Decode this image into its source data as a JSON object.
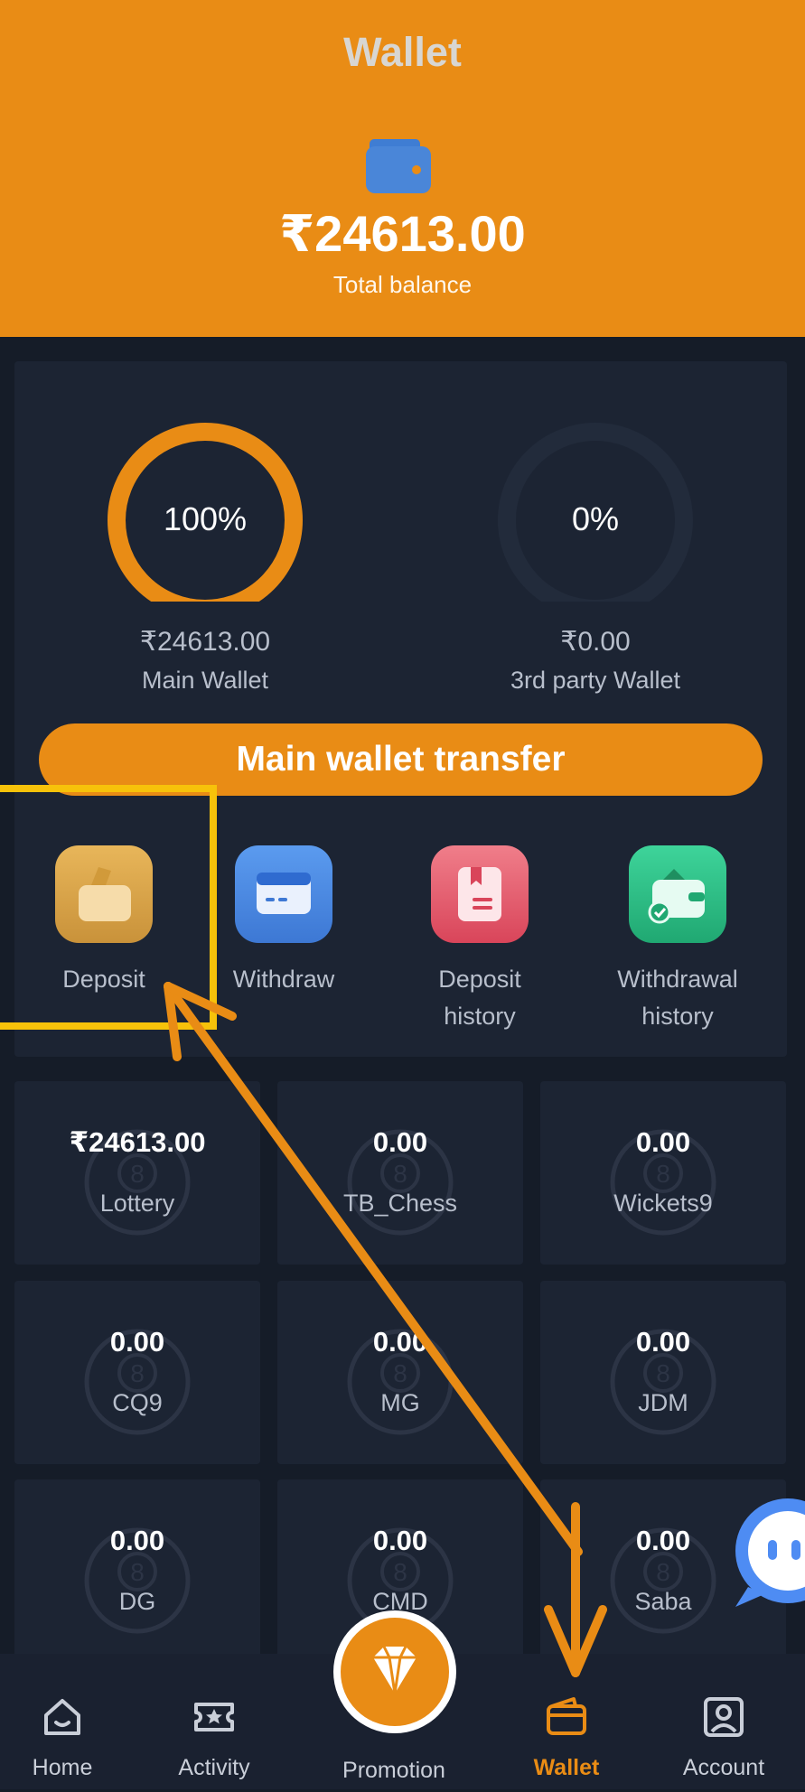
{
  "header": {
    "title": "Wallet",
    "total_amount": "₹24613.00",
    "total_label": "Total balance",
    "icon": "wallet-icon"
  },
  "wallets": {
    "main": {
      "percent": "100%",
      "amount": "₹24613.00",
      "label": "Main Wallet",
      "fill": 1.0
    },
    "third_party": {
      "percent": "0%",
      "amount": "₹0.00",
      "label": "3rd party Wallet",
      "fill": 0.0
    }
  },
  "transfer_button": "Main wallet transfer",
  "actions": [
    {
      "label": "Deposit",
      "icon": "deposit-icon"
    },
    {
      "label": "Withdraw",
      "icon": "withdraw-card-icon"
    },
    {
      "label": "Deposit history",
      "icon": "deposit-history-icon"
    },
    {
      "label": "Withdrawal history",
      "icon": "withdrawal-history-icon"
    }
  ],
  "games": [
    {
      "value": "₹24613.00",
      "name": "Lottery"
    },
    {
      "value": "0.00",
      "name": "TB_Chess"
    },
    {
      "value": "0.00",
      "name": "Wickets9"
    },
    {
      "value": "0.00",
      "name": "CQ9"
    },
    {
      "value": "0.00",
      "name": "MG"
    },
    {
      "value": "0.00",
      "name": "JDM"
    },
    {
      "value": "0.00",
      "name": "DG"
    },
    {
      "value": "0.00",
      "name": "CMD"
    },
    {
      "value": "0.00",
      "name": "Saba"
    }
  ],
  "nav": [
    {
      "label": "Home",
      "icon": "home-icon",
      "active": false
    },
    {
      "label": "Activity",
      "icon": "activity-ticket-icon",
      "active": false
    },
    {
      "label": "Promotion",
      "icon": "diamond-icon",
      "active": false
    },
    {
      "label": "Wallet",
      "icon": "wallet-icon",
      "active": true
    },
    {
      "label": "Account",
      "icon": "account-icon",
      "active": false
    }
  ],
  "colors": {
    "accent": "#e98c15",
    "background": "#151c28",
    "panel": "#1c2433",
    "annotation_box": "#f7c20a",
    "annotation_arrow": "#e98c15"
  }
}
